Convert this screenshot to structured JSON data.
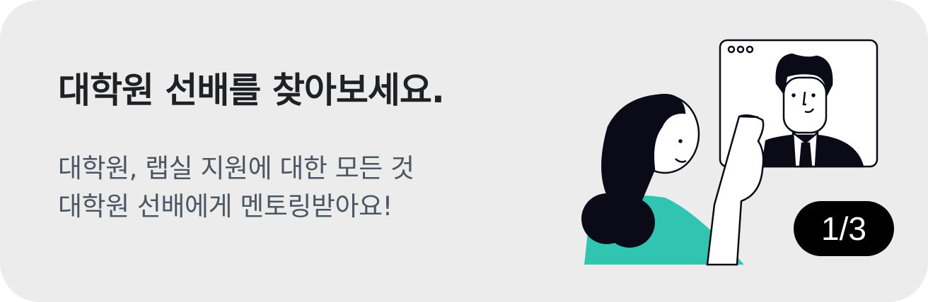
{
  "banner": {
    "title": "대학원 선배를 찾아보세요.",
    "subtitle_lines": [
      "대학원, 랩실 지원에 대한 모든 것",
      "대학원 선배에게 멘토링받아요!"
    ],
    "page_indicator": "1/3",
    "colors": {
      "background": "#ececec",
      "accent": "#31c4b1",
      "ink": "#0b0b18"
    }
  }
}
